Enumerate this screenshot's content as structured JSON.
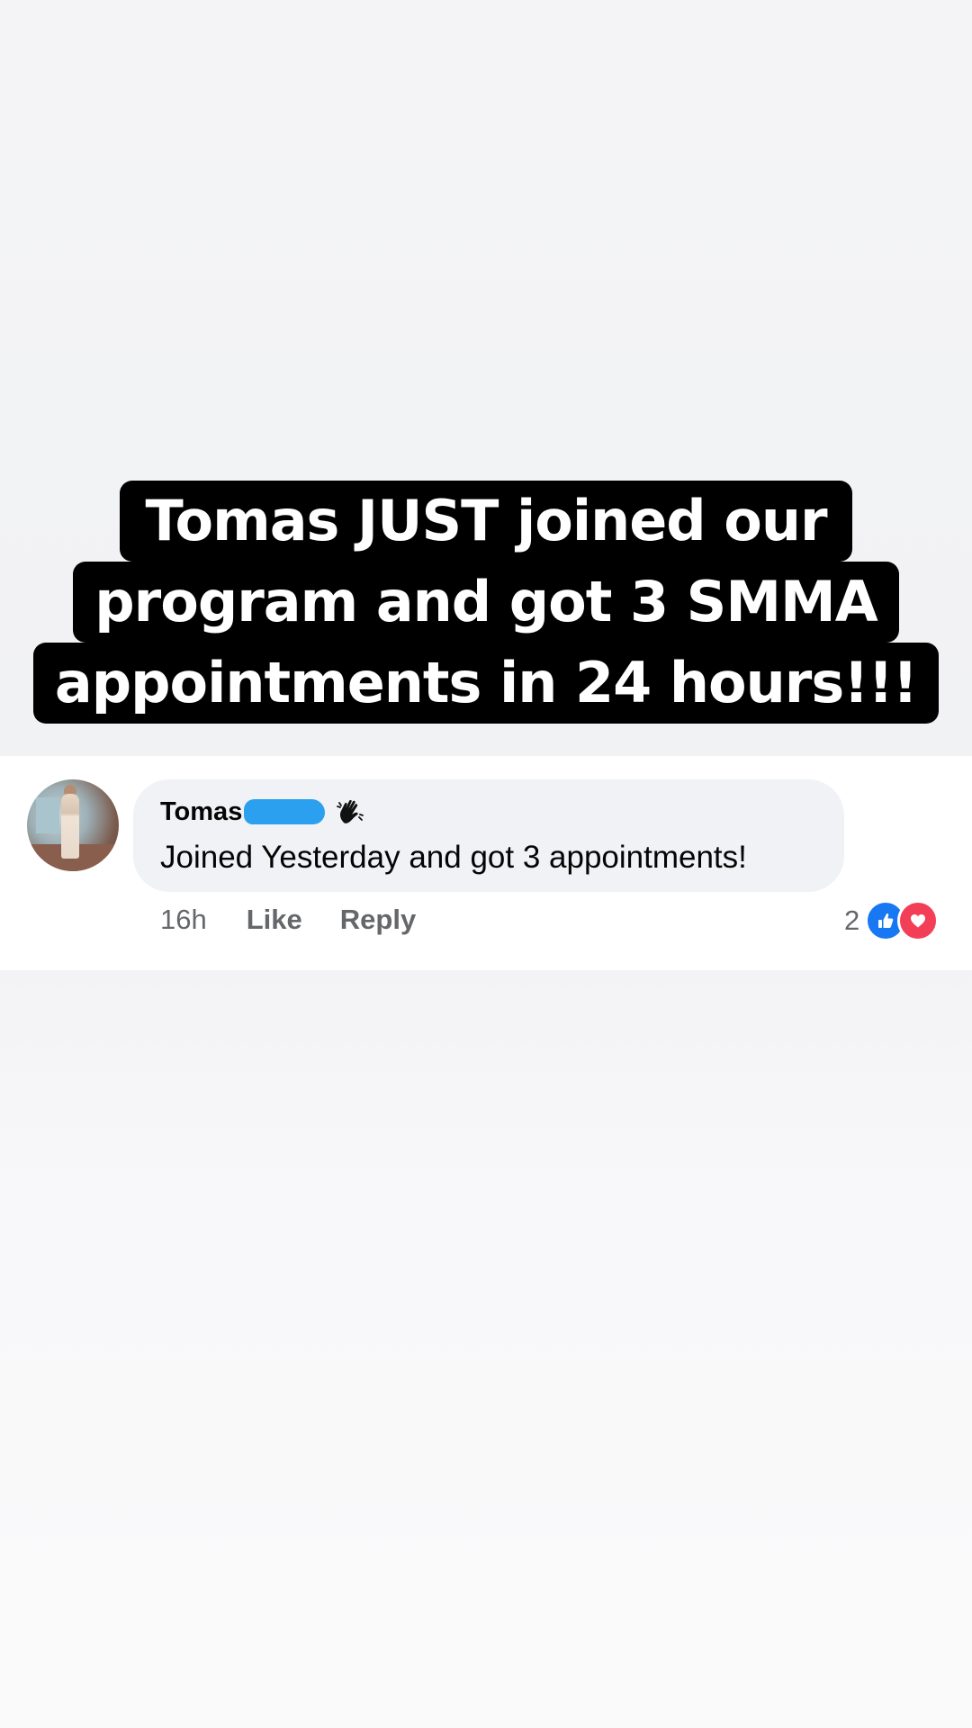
{
  "headline": {
    "lines": [
      "Tomas JUST joined our",
      "program and got 3 SMMA",
      "appointments in 24 hours!!!"
    ]
  },
  "comment": {
    "author": "Tomas",
    "author_redacted": true,
    "badge_icon": "waving-hand-icon",
    "text": "Joined Yesterday and got 3 appointments!",
    "time": "16h",
    "like_label": "Like",
    "reply_label": "Reply",
    "reaction_count": "2",
    "reactions": [
      "like-icon",
      "love-icon"
    ],
    "colors": {
      "like": "#1877f2",
      "love": "#f33e58",
      "redaction": "#2aa0ee"
    }
  }
}
